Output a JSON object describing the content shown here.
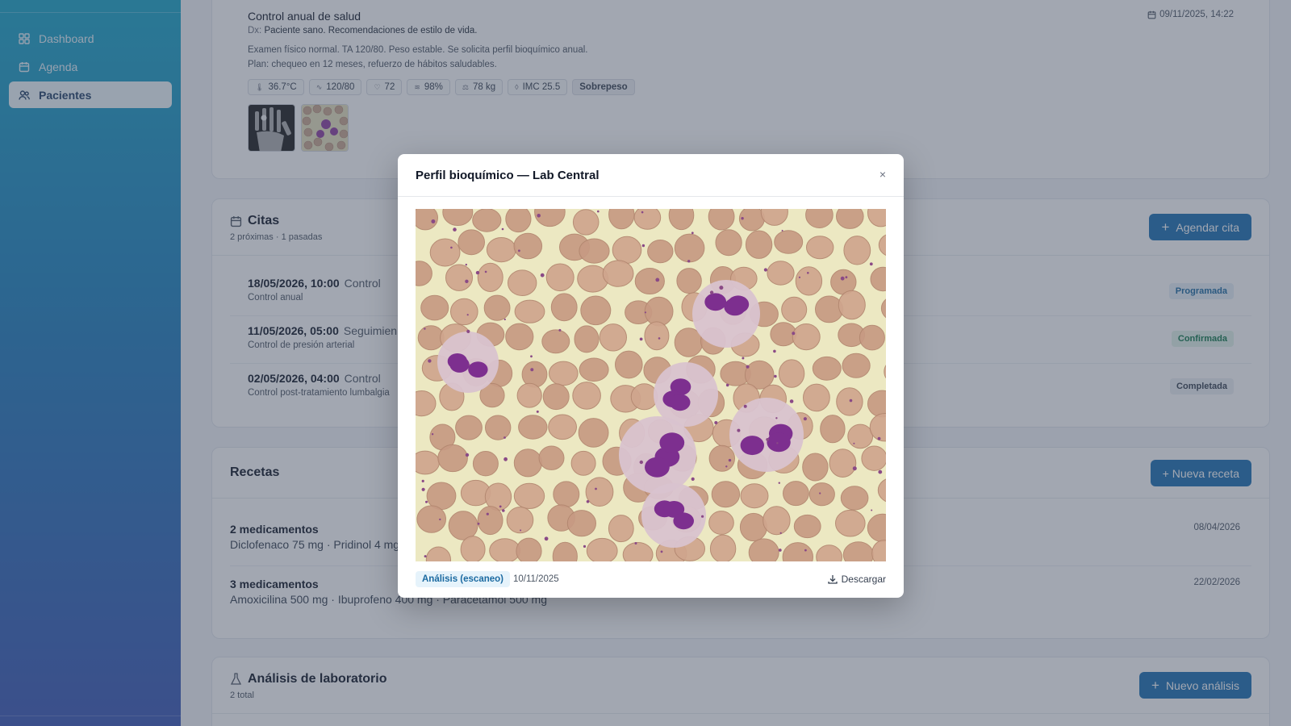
{
  "sidebar": {
    "items": [
      {
        "label": "Dashboard",
        "icon": "grid-icon"
      },
      {
        "label": "Agenda",
        "icon": "calendar-icon"
      },
      {
        "label": "Pacientes",
        "icon": "users-icon",
        "active": true
      }
    ]
  },
  "consult": {
    "title": "Control anual de salud",
    "datetime": "09/11/2025, 14:22",
    "dx_label": "Dx:",
    "dx": "Paciente sano. Recomendaciones de estilo de vida.",
    "exam": "Examen físico normal. TA 120/80. Peso estable. Se solicita perfil bioquímico anual.",
    "plan": "Plan: chequeo en 12 meses, refuerzo de hábitos saludables.",
    "vitals": [
      {
        "icon": "thermometer-icon",
        "glyph": "🌡",
        "value": "36.7°C"
      },
      {
        "icon": "pulse-icon",
        "glyph": "∿",
        "value": "120/80"
      },
      {
        "icon": "heart-icon",
        "glyph": "♡",
        "value": "72"
      },
      {
        "icon": "lungs-icon",
        "glyph": "≋",
        "value": "98%"
      },
      {
        "icon": "scale-icon",
        "glyph": "⚖",
        "value": "78 kg"
      },
      {
        "icon": "drop-icon",
        "glyph": "◊",
        "value": "IMC 25.5"
      }
    ],
    "tag": "Sobrepeso"
  },
  "citas": {
    "title": "Citas",
    "subtitle": "2 próximas · 1 pasadas",
    "button": "Agendar cita",
    "items": [
      {
        "when": "18/05/2026, 10:00",
        "type": "Control",
        "desc": "Control anual",
        "status": "Programada",
        "status_color": "#1b6aa1",
        "status_bg": "#e6f0f8"
      },
      {
        "when": "11/05/2026, 05:00",
        "type": "Seguimien",
        "desc": "Control de presión arterial",
        "status": "Confirmada",
        "status_color": "#127a4d",
        "status_bg": "#e3f4ea"
      },
      {
        "when": "02/05/2026, 04:00",
        "type": "Control",
        "desc": "Control post-tratamiento lumbalgia",
        "status": "Completada",
        "status_color": "#374151",
        "status_bg": "#eceff3"
      }
    ]
  },
  "recetas": {
    "title": "Recetas",
    "button": "+ Nueva receta",
    "items": [
      {
        "count": "2 medicamentos",
        "meds": "Diclofenaco 75 mg · Pridinol 4 mg",
        "date": "08/04/2026"
      },
      {
        "count": "3 medicamentos",
        "meds": "Amoxicilina 500 mg · Ibuprofeno 400 mg · Paracetamol 500 mg",
        "date": "22/02/2026"
      }
    ]
  },
  "analisis": {
    "title": "Análisis de laboratorio",
    "subtitle": "2 total",
    "button": "Nuevo análisis"
  },
  "modal": {
    "title": "Perfil bioquímico — Lab Central",
    "close": "×",
    "doc_type": "Análisis (escaneo)",
    "date": "10/11/2025",
    "download": "Descargar"
  }
}
